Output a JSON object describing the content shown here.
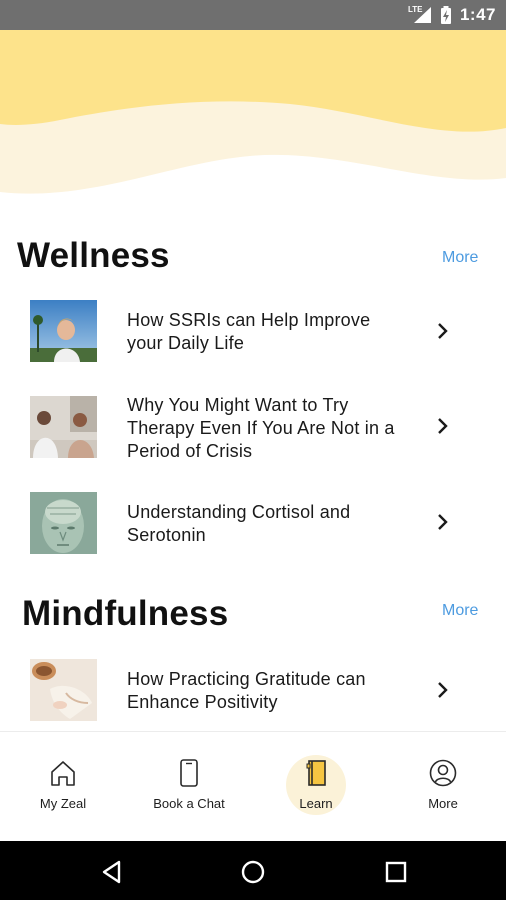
{
  "status_bar": {
    "network": "LTE",
    "time": "1:47"
  },
  "sections": [
    {
      "title": "Wellness",
      "more_label": "More",
      "articles": [
        {
          "title": "How SSRIs can Help Improve your Daily Life"
        },
        {
          "title": "Why You Might Want to Try Therapy Even If You Are Not in a Period of Crisis"
        },
        {
          "title": "Understanding Cortisol and Serotonin"
        }
      ]
    },
    {
      "title": "Mindfulness",
      "more_label": "More",
      "articles": [
        {
          "title": "How Practicing Gratitude can Enhance Positivity"
        }
      ]
    }
  ],
  "bottom_nav": {
    "items": [
      {
        "label": "My Zeal",
        "icon": "home-icon",
        "active": false
      },
      {
        "label": "Book a Chat",
        "icon": "phone-icon",
        "active": false
      },
      {
        "label": "Learn",
        "icon": "book-icon",
        "active": true
      },
      {
        "label": "More",
        "icon": "profile-icon",
        "active": false
      }
    ]
  },
  "colors": {
    "hero_yellow": "#fde38b",
    "hero_cream": "#fcf3dd",
    "accent_link": "#4d9be0",
    "active_nav_bg": "#fbf2d8",
    "status_bar": "#6f6f6f"
  }
}
